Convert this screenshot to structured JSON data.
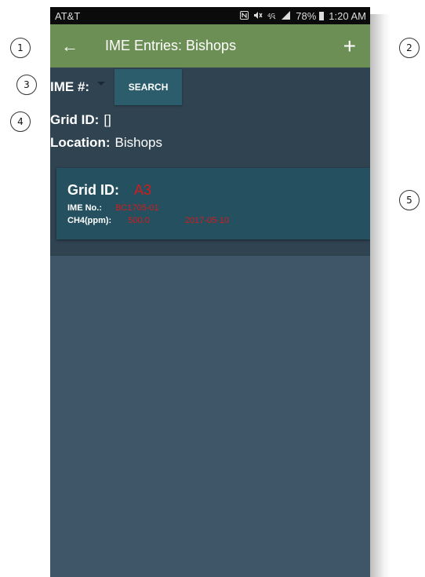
{
  "callouts": [
    "1",
    "2",
    "3",
    "4",
    "5"
  ],
  "status_bar": {
    "carrier": "AT&T",
    "icons": [
      "nfc-icon",
      "mute-icon",
      "lte-icon",
      "signal-icon"
    ],
    "battery": "78%",
    "time": "1:20 AM"
  },
  "app_bar": {
    "title": "IME Entries: Bishops",
    "back_icon": "←",
    "add_icon": "+"
  },
  "form": {
    "ime_label": "IME #:",
    "search_label": "SEARCH",
    "grid_label": "Grid ID:",
    "grid_value": "[]",
    "location_label": "Location:",
    "location_value": "Bishops"
  },
  "entries": [
    {
      "grid_label": "Grid ID:",
      "grid_value": "A3",
      "ime_label": "IME No.:",
      "ime_value": "BC1705-01",
      "ch4_label": "CH4(ppm):",
      "ch4_value": "500.0",
      "date": "2017-05-10"
    }
  ],
  "colors": {
    "app_bar": "#6c8f55",
    "form_bg": "#2f4351",
    "list_bg": "#3e5667",
    "card_bg": "#245060",
    "accent_red": "#d41b1b"
  }
}
